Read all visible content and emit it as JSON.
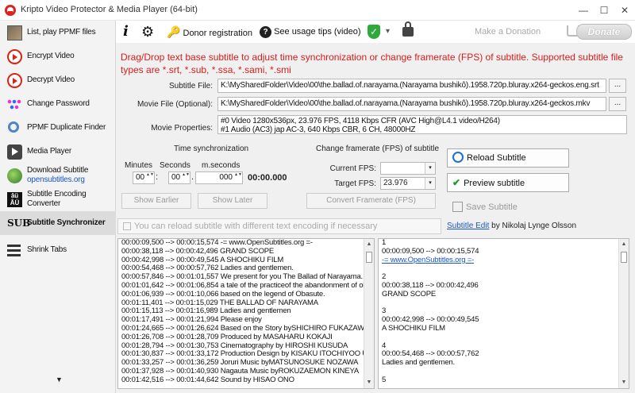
{
  "window": {
    "title": "Kripto Video Protector & Media Player (64-bit)",
    "minimize": "—",
    "maximize": "☐",
    "close": "✕"
  },
  "sidebar": {
    "items": [
      {
        "label": "List, play PPMF files"
      },
      {
        "label": "Encrypt Video"
      },
      {
        "label": "Decrypt Video"
      },
      {
        "label": "Change Password"
      },
      {
        "label": "PPMF Duplicate Finder"
      },
      {
        "label": "Media Player"
      },
      {
        "label": "Download Subtitle",
        "sub": "opensubtitles.org"
      },
      {
        "label": "Subtitle Encoding",
        "sub": "Converter"
      },
      {
        "label": "Subtitle Synchronizer"
      },
      {
        "label": "Shrink Tabs"
      }
    ],
    "scroll_down": "▼"
  },
  "toolbar": {
    "donor": "Donor registration",
    "tips": "See usage tips (video)",
    "shield_dropdown": "▾",
    "make_donation": "Make a Donation",
    "donate": "Donate"
  },
  "instruction": "Drag/Drop text base subtitle to adjust time synchronization or change framerate (FPS) of subtitle. Supported subtitle file types are *.srt, *.sub, *.ssa, *.sami, *.smi",
  "form": {
    "subtitle_label": "Subtitle File:",
    "subtitle_value": "K:\\MySharedFolder\\Video\\00\\the.ballad.of.narayama.(Narayama bushikô).1958.720p.bluray.x264-geckos.eng.srt",
    "movie_label": "Movie File (Optional):",
    "movie_value": "K:\\MySharedFolder\\Video\\00\\the.ballad.of.narayama.(Narayama bushikô).1958.720p.bluray.x264-geckos.mkv",
    "props_label": "Movie Properties:",
    "props_line1": "#0 Video 1280x536px, 23.976 FPS, 4118 Kbps CFR (AVC High@L4.1 video/H264)",
    "props_line2": "#1 Audio (AC3) jap AC-3, 640 Kbps CBR, 6 CH, 48000HZ",
    "browse": "..."
  },
  "timesync": {
    "title": "Time synchronization",
    "minutes": "Minutes",
    "seconds": "Seconds",
    "mseconds": "m.seconds",
    "min_value": "00",
    "sec_value": "00",
    "ms_value": "000",
    "colon": ":",
    "dot": ".",
    "spin_arrows": "▲▼",
    "total": "00:00.000",
    "show_earlier": "Show Earlier",
    "show_later": "Show Later"
  },
  "framerate": {
    "title": "Change framerate (FPS) of subtitle",
    "current_label": "Current FPS:",
    "current_value": "",
    "target_label": "Target FPS:",
    "target_value": "23.976",
    "arrow": "▾",
    "convert": "Convert Framerate (FPS)"
  },
  "actions": {
    "reload": "Reload Subtitle",
    "preview": "Preview subtitle",
    "preview_check": "✔",
    "save": "Save Subtitle"
  },
  "reload_hint": "You can reload subtitle with different text encoding if necessary",
  "credit": {
    "link": "Subtitle Edit",
    "rest": " by Nikolaj Lynge Olsson"
  },
  "left_pane": {
    "lines": [
      "00:00:09,500 --> 00:00:15,574 -= www.OpenSubtitles.org =-",
      "00:00:38,118 --> 00:00:42,496 GRAND SCOPE",
      "00:00:42,998 --> 00:00:49,545 A SHOCHIKU FILM",
      "00:00:54,468 --> 00:00:57,762 Ladies and gentlemen.",
      "00:00:57,846 --> 00:01:01,557 We present for you The Ballad of Narayama.",
      "00:01:01,642 --> 00:01:06,854 a tale of the practiceof the abandonment of old",
      "00:01:06,939 --> 00:01:10,066 based on the legend of Obasute.",
      "00:01:11,401 --> 00:01:15,029 THE BALLAD OF NARAYAMA",
      "00:01:15,113 --> 00:01:16,989 Ladies and gentlemen",
      "00:01:17,491 --> 00:01:21,994 Please enjoy",
      "00:01:24,665 --> 00:01:26,624 Based on the Story bySHICHIRO FUKAZAWA",
      "00:01:26,708 --> 00:01:28,709 Produced by MASAHARU KOKAJI",
      "00:01:28,794 --> 00:01:30,753 Cinematography by HIROSHI KUSUDA",
      "00:01:30,837 --> 00:01:33,172 Production Design by KISAKU ITOCHIYOO UM",
      "00:01:33,257 --> 00:01:36,259 Joruri Music byMATSUNOSUKE NOZAWA",
      "00:01:37,928 --> 00:01:40,930 Nagauta Music byROKUZAEMON KINEYA",
      "00:01:42,516 --> 00:01:44,642 Sound by HISAO ONO"
    ]
  },
  "right_pane": {
    "lines": [
      {
        "t": "1"
      },
      {
        "t": "00:00:09,500 --> 00:00:15,574"
      },
      {
        "t": "-= www.OpenSubtitles.org =-",
        "link": true
      },
      {
        "t": ""
      },
      {
        "t": "2"
      },
      {
        "t": "00:00:38,118 --> 00:00:42,496"
      },
      {
        "t": "GRAND SCOPE"
      },
      {
        "t": ""
      },
      {
        "t": "3"
      },
      {
        "t": "00:00:42,998 --> 00:00:49,545"
      },
      {
        "t": "A SHOCHIKU FILM"
      },
      {
        "t": ""
      },
      {
        "t": "4"
      },
      {
        "t": "00:00:54,468 --> 00:00:57,762"
      },
      {
        "t": "Ladies and gentlemen."
      },
      {
        "t": ""
      },
      {
        "t": "5"
      }
    ]
  },
  "scroll": {
    "up": "▲",
    "down": "▼"
  }
}
